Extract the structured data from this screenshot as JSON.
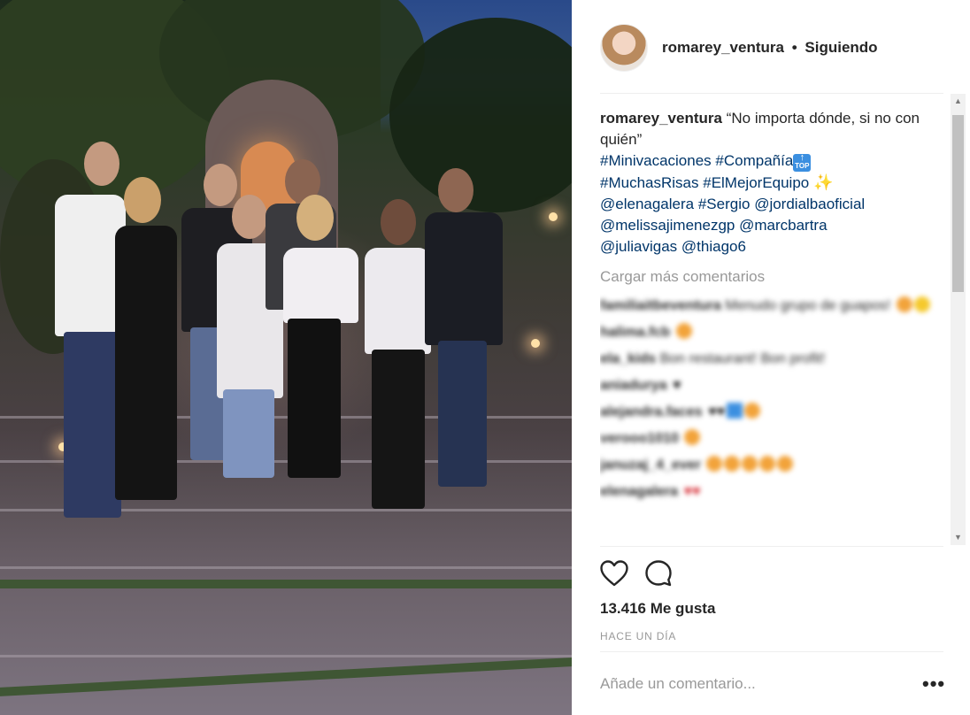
{
  "post": {
    "username": "romarey_ventura",
    "follow_separator": "•",
    "follow_status": "Siguiendo"
  },
  "caption": {
    "username": "romarey_ventura",
    "text": "“No importa dónde, si no con quién”",
    "tags_line1": [
      "#Minivacaciones",
      "#Compañía"
    ],
    "top_emoji_text": "TOP",
    "tags_line2": [
      "#MuchasRisas",
      "#ElMejorEquipo"
    ],
    "sparkle_emoji": "✨",
    "mentions_line3": [
      "@elenagalera",
      "#Sergio",
      "@jordialbaoficial"
    ],
    "mentions_line4": [
      "@melissajimenezgp",
      "@marcbartra"
    ],
    "mentions_line5": [
      "@juliavigas",
      "@thiago6"
    ]
  },
  "load_more_label": "Cargar más comentarios",
  "comments": [
    {
      "user": "familiaitbeventura",
      "text": "Menudo grupo de guapos!"
    },
    {
      "user": "halima.fcb",
      "text": ""
    },
    {
      "user": "ela_kids",
      "text": "Bon restaurant! Bon profit!"
    },
    {
      "user": "aniadurya",
      "text": ""
    },
    {
      "user": "alejandra.faces",
      "text": ""
    },
    {
      "user": "verooo1010",
      "text": ""
    },
    {
      "user": "januzaj_4_ever",
      "text": ""
    },
    {
      "user": "elenagalera",
      "text": ""
    }
  ],
  "likes_label": "13.416 Me gusta",
  "time_label": "HACE UN DÍA",
  "comment_placeholder": "Añade un comentario...",
  "more_label": "•••",
  "icons": {
    "like": "heart-outline-icon",
    "comment": "speech-bubble-icon",
    "more": "ellipsis-icon"
  },
  "colors": {
    "link": "#003569",
    "muted": "#999999",
    "text": "#262626",
    "divider": "#efefef"
  }
}
